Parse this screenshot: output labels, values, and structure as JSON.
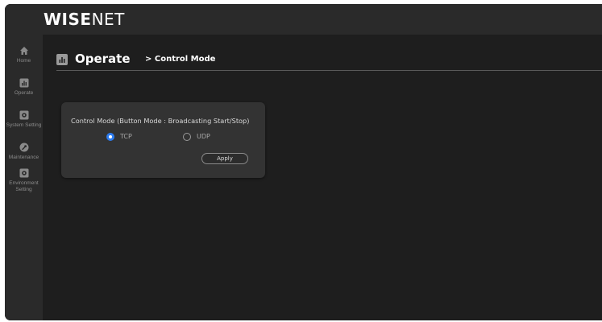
{
  "brand": {
    "logo_bold": "WISE",
    "logo_light": "NET"
  },
  "sidebar": {
    "items": [
      {
        "label": "Home",
        "icon": "home-icon"
      },
      {
        "label": "Operate",
        "icon": "operate-icon"
      },
      {
        "label": "System Setting",
        "icon": "gear-icon"
      },
      {
        "label": "Maintenance",
        "icon": "wrench-icon"
      },
      {
        "label": "Environment",
        "label2": "Setting",
        "icon": "gear-icon"
      }
    ]
  },
  "page": {
    "title": "Operate",
    "subtitle": "> Control Mode"
  },
  "control_mode": {
    "title": "Control Mode (Button Mode : Broadcasting Start/Stop)",
    "options": [
      {
        "label": "TCP",
        "selected": true
      },
      {
        "label": "UDP",
        "selected": false
      }
    ],
    "apply_label": "Apply"
  },
  "colors": {
    "accent": "#2d7cf0",
    "background": "#1e1e1e",
    "panel": "#333333"
  }
}
